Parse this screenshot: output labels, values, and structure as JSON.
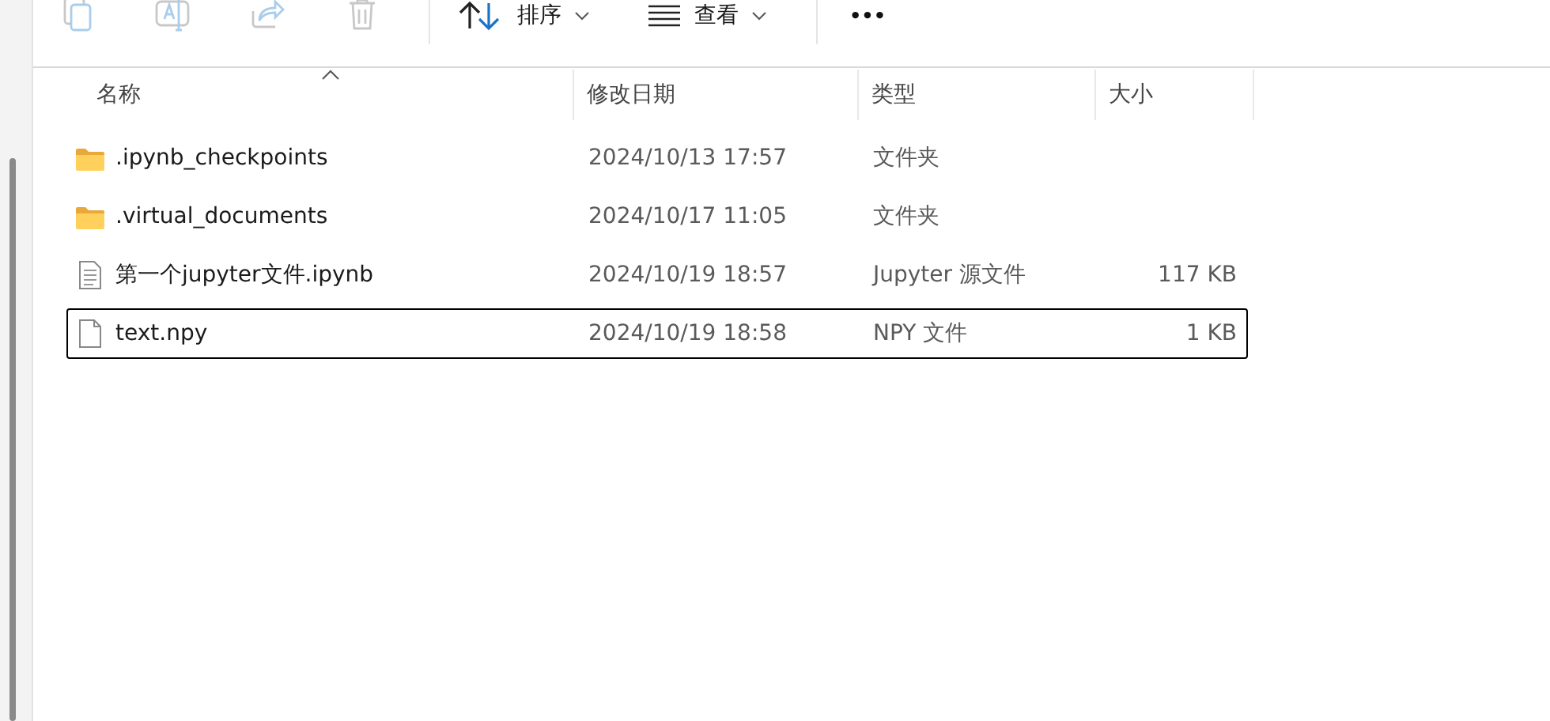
{
  "toolbar": {
    "actions": [
      {
        "kind": "copy",
        "disabled": true
      },
      {
        "kind": "rename",
        "disabled": true
      },
      {
        "kind": "share",
        "disabled": true
      },
      {
        "kind": "delete",
        "disabled": true
      }
    ],
    "sort_button": {
      "label": "排序"
    },
    "view_button": {
      "label": "查看"
    },
    "more_button": {
      "label": "•••"
    }
  },
  "table": {
    "columns": [
      {
        "label": "名称",
        "sorted": true
      },
      {
        "label": "修改日期",
        "sorted": false
      },
      {
        "label": "类型",
        "sorted": false
      },
      {
        "label": "大小",
        "sorted": false
      }
    ],
    "rows": [
      {
        "kind": "folder",
        "name": ".ipynb_checkpoints",
        "modified": "2024/10/13 17:57",
        "type": "文件夹",
        "selected": false
      },
      {
        "kind": "folder",
        "name": ".virtual_documents",
        "modified": "2024/10/17 11:05",
        "type": "文件夹",
        "selected": false
      },
      {
        "kind": "notebook",
        "name": "第一个jupyter文件.ipynb",
        "modified": "2024/10/19 18:57",
        "type": "Jupyter 源文件",
        "size": "117 KB",
        "selected": false
      },
      {
        "kind": "file",
        "name": "text.npy",
        "modified": "2024/10/19 18:58",
        "type": "NPY 文件",
        "size": "1 KB",
        "selected": true
      }
    ]
  }
}
